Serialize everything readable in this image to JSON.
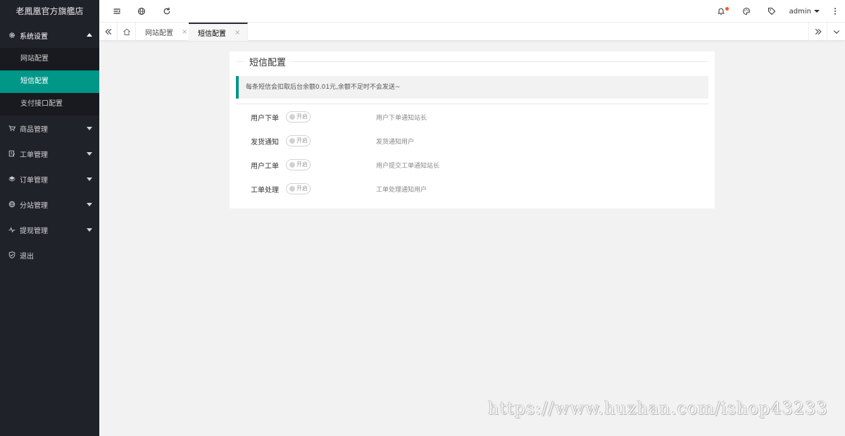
{
  "sidebar": {
    "logo": "老鳳凰官方旗艦店",
    "items": [
      {
        "label": "系统设置",
        "icon": "gear-icon",
        "open": true,
        "children": [
          {
            "label": "网站配置",
            "active": false
          },
          {
            "label": "短信配置",
            "active": true
          },
          {
            "label": "支付接口配置",
            "active": false
          }
        ]
      },
      {
        "label": "商品管理",
        "icon": "cart-icon"
      },
      {
        "label": "工单管理",
        "icon": "ticket-icon"
      },
      {
        "label": "订单管理",
        "icon": "layers-icon"
      },
      {
        "label": "分站管理",
        "icon": "globe-icon"
      },
      {
        "label": "提现管理",
        "icon": "pulse-icon"
      },
      {
        "label": "退出",
        "icon": "shield-icon"
      }
    ]
  },
  "header": {
    "left_icons": [
      "menu-fold-icon",
      "globe-icon",
      "refresh-icon"
    ],
    "right_icons": [
      "bell-icon",
      "palette-icon",
      "tag-icon"
    ],
    "user": "admin"
  },
  "tabs": {
    "items": [
      {
        "label": "网站配置",
        "close": "×",
        "active": false
      },
      {
        "label": "短信配置",
        "close": "×",
        "active": true
      }
    ]
  },
  "card": {
    "legend": "短信配置",
    "notice": "每条短信会扣取后台余额0.01元,余额不足时不会发送~",
    "rows": [
      {
        "label": "用户下单",
        "switch_text": "开启",
        "enabled": false,
        "desc": "用户下单通知站长"
      },
      {
        "label": "发货通知",
        "switch_text": "开启",
        "enabled": false,
        "desc": "发货通知用户"
      },
      {
        "label": "用户工单",
        "switch_text": "开启",
        "enabled": false,
        "desc": "用户提交工单通知站长"
      },
      {
        "label": "工单处理",
        "switch_text": "开启",
        "enabled": false,
        "desc": "工单处理通知用户"
      }
    ]
  },
  "watermark": "https://www.huzhan.com/ishop43233",
  "colors": {
    "sidebar_bg": "#20222a",
    "submenu_bg": "#181a1f",
    "accent": "#009688",
    "badge": "#ff5722"
  }
}
